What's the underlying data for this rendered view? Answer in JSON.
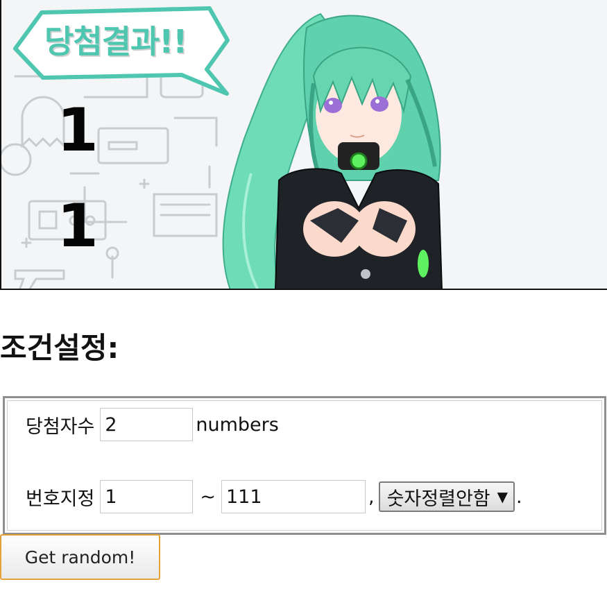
{
  "banner": {
    "bubble_text": "당첨결과!!",
    "results": [
      "1",
      "1"
    ]
  },
  "settings": {
    "title": "조건설정:",
    "count_label": "당첨자수",
    "count_value": "2",
    "count_unit": "numbers",
    "range_label": "번호지정",
    "range_min": "1",
    "range_separator": "~",
    "range_max": "111",
    "comma": ",",
    "sort_selected": "숫자정렬안함",
    "period": "."
  },
  "actions": {
    "get_random_label": "Get random!"
  },
  "colors": {
    "accent_teal": "#4fc7b0",
    "button_focus": "#e3a13a"
  }
}
